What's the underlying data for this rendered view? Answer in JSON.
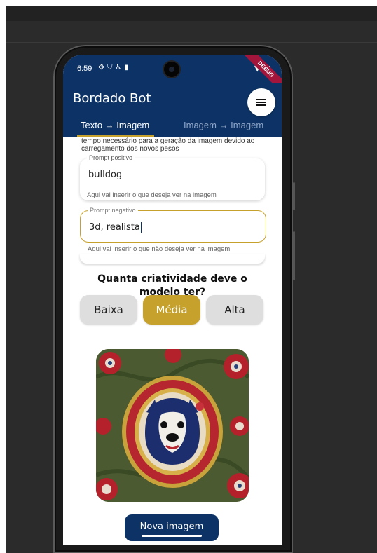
{
  "colors": {
    "primary": "#0d3366",
    "accent": "#c6a12b",
    "chip_bg": "#dedede",
    "debug_ribbon": "#a3153b"
  },
  "status_bar": {
    "time": "6:59",
    "icons": [
      "settings-icon",
      "shield-icon",
      "accessibility-icon",
      "sd-card-icon"
    ],
    "right_icons": [
      "wifi-icon",
      "signal-icon",
      "battery-icon"
    ],
    "debug_label": "DEBUG"
  },
  "app_bar": {
    "title": "Bordado Bot",
    "menu_icon": "menu-icon"
  },
  "tabs": [
    {
      "label": "Texto → Imagem",
      "selected": true
    },
    {
      "label": "Imagem → Imagem",
      "selected": false
    }
  ],
  "main": {
    "info_text": "tempo necessário para a geração da imagem devido ao carregamento dos novos pesos",
    "positive_prompt": {
      "label": "Prompt positivo",
      "value": "bulldog",
      "hint": "Aqui vai inserir o que deseja ver na imagem"
    },
    "negative_prompt": {
      "label": "Prompt negativo",
      "value": "3d, realista",
      "hint": "Aqui vai inserir o que não deseja ver na imagem"
    },
    "question": "Quanta criatividade deve o modelo ter?",
    "options": [
      {
        "label": "Baixa",
        "selected": false
      },
      {
        "label": "Média",
        "selected": true
      },
      {
        "label": "Alta",
        "selected": false
      }
    ],
    "new_image_button": "Nova imagem"
  }
}
